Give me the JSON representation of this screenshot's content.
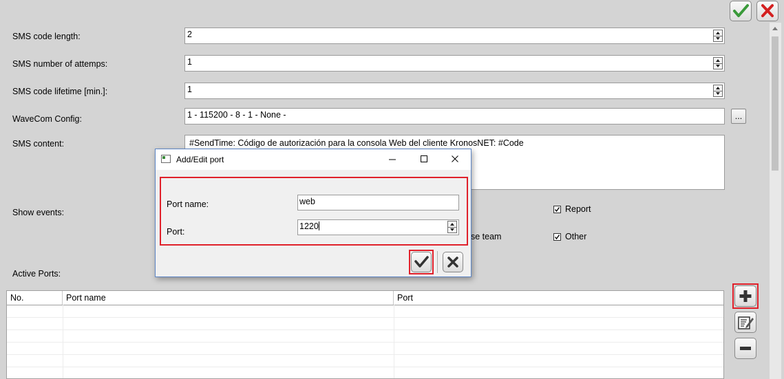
{
  "top_actions": {
    "confirm_icon": "check-icon",
    "cancel_icon": "close-icon"
  },
  "form": {
    "sms_code_length": {
      "label": "SMS code length:",
      "value": "2"
    },
    "sms_attempts": {
      "label": "SMS number of attemps:",
      "value": "1"
    },
    "sms_lifetime": {
      "label": "SMS code lifetime [min.]:",
      "value": "1"
    },
    "wavecom": {
      "label": "WaveCom Config:",
      "value": "1 - 115200 - 8 - 1 - None -",
      "browse_label": "..."
    },
    "sms_content": {
      "label": "SMS content:",
      "value": "#SendTime: Código de autorización para la consola Web del cliente KronosNET: #Code"
    },
    "show_events": {
      "label": "Show events:",
      "partial_text": "se team",
      "options": [
        {
          "label": "Report",
          "checked": true
        },
        {
          "label": "Other",
          "checked": true
        }
      ]
    },
    "active_ports_label": "Active Ports:"
  },
  "ports_table": {
    "columns": [
      "No.",
      "Port name",
      "Port"
    ],
    "rows": []
  },
  "side_buttons": {
    "add_icon": "plus-icon",
    "edit_icon": "edit-icon",
    "remove_icon": "minus-icon"
  },
  "dialog": {
    "title": "Add/Edit port",
    "port_name_label": "Port name:",
    "port_name_value": "web",
    "port_label": "Port:",
    "port_value": "1220",
    "highlight_color": "#e0202a"
  }
}
